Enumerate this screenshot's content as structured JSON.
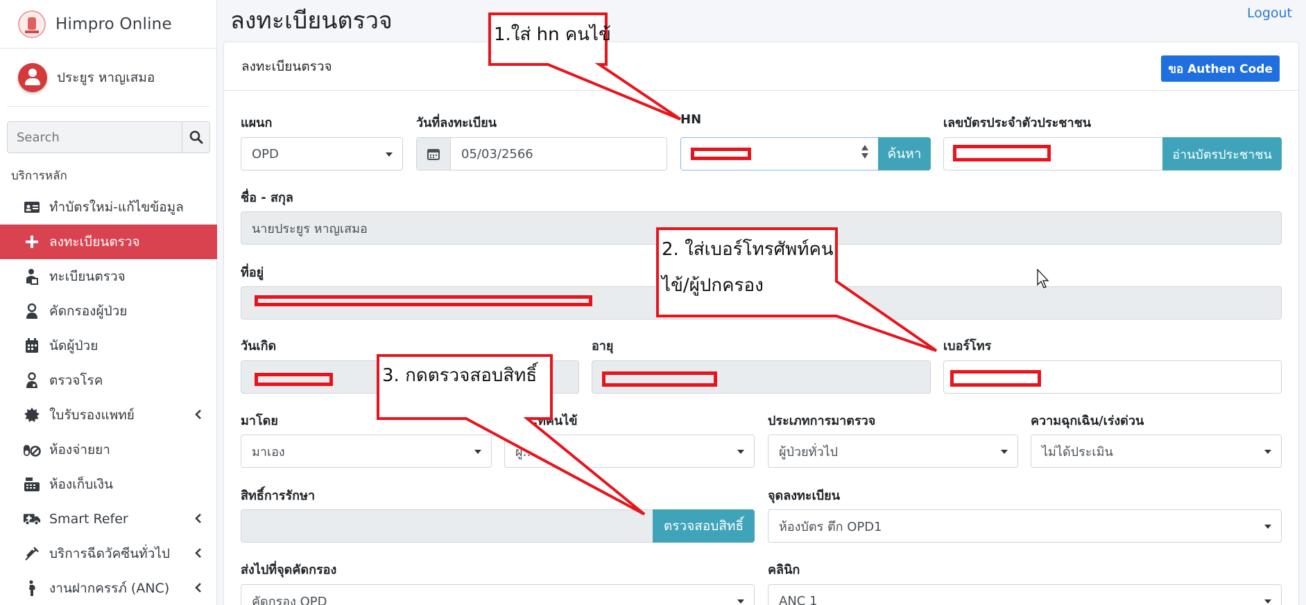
{
  "app": {
    "brand": "Himpro Online",
    "page_title": "ลงทะเบียนตรวจ",
    "logout": "Logout"
  },
  "user": {
    "name": "ประยูร หาญเสมอ"
  },
  "search": {
    "placeholder": "Search"
  },
  "sidebar": {
    "section": "บริการหลัก",
    "items": [
      {
        "label": "ทำบัตรใหม่-แก้ไขข้อมูล",
        "icon": "id-card-icon",
        "active": false
      },
      {
        "label": "ลงทะเบียนตรวจ",
        "icon": "plus-icon",
        "active": true
      },
      {
        "label": "ทะเบียนตรวจ",
        "icon": "patient-list-icon",
        "active": false
      },
      {
        "label": "คัดกรองผู้ป่วย",
        "icon": "nurse-icon",
        "active": false
      },
      {
        "label": "นัดผู้ป่วย",
        "icon": "calendar-icon",
        "active": false
      },
      {
        "label": "ตรวจโรค",
        "icon": "doctor-icon",
        "active": false
      },
      {
        "label": "ใบรับรองแพทย์",
        "icon": "certificate-icon",
        "active": false
      },
      {
        "label": "ห้องจ่ายยา",
        "icon": "pills-icon",
        "active": false
      },
      {
        "label": "ห้องเก็บเงิน",
        "icon": "cash-register-icon",
        "active": false
      },
      {
        "label": "Smart Refer",
        "icon": "ambulance-icon",
        "active": false
      },
      {
        "label": "บริการฉีดวัคซีนทั่วไป",
        "icon": "syringe-icon",
        "active": false
      },
      {
        "label": "งานฝากครรภ์ (ANC)",
        "icon": "pregnant-icon",
        "active": false
      }
    ]
  },
  "card": {
    "title": "ลงทะเบียนตรวจ",
    "authen_button": "ขอ Authen Code"
  },
  "form": {
    "department": {
      "label": "แผนก",
      "value": "OPD"
    },
    "register_date": {
      "label": "วันที่ลงทะเบียน",
      "value": "05/03/2566"
    },
    "hn": {
      "label": "HN",
      "button": "ค้นหา"
    },
    "citizen_id": {
      "label": "เลขบัตรประจำตัวประชาชน",
      "button": "อ่านบัตรประชาชน"
    },
    "fullname": {
      "label": "ชื่อ - สกุล",
      "value": "นายประยูร หาญเสมอ"
    },
    "address": {
      "label": "ที่อยู่"
    },
    "birthdate": {
      "label": "วันเกิด"
    },
    "age": {
      "label": "อายุ"
    },
    "phone": {
      "label": "เบอร์โทร"
    },
    "arrival": {
      "label": "มาโดย",
      "value": "มาเอง"
    },
    "patient_type": {
      "label": "…ท่คนไข้",
      "value": "ผู้…"
    },
    "exam_type": {
      "label": "ประเภทการมาตรวจ",
      "value": "ผู้ป่วยทั่วไป"
    },
    "urgency": {
      "label": "ความฉุกเฉิน/เร่งด่วน",
      "value": "ไม่ได้ประเมิน"
    },
    "right": {
      "label": "สิทธิ์การรักษา",
      "button": "ตรวจสอบสิทธิ์"
    },
    "register_point": {
      "label": "จุดลงทะเบียน",
      "value": "ห้องบัตร ตึก OPD1"
    },
    "send_to": {
      "label": "ส่งไปที่จุดคัดกรอง",
      "value": "คัดกรอง OPD"
    },
    "clinic": {
      "label": "คลินิก",
      "value": "ANC 1"
    }
  },
  "annotations": {
    "step1": "1.ใส่ hn คนไข้",
    "step2_line1": "2. ใส่เบอร์โทรศัพท์คน",
    "step2_line2": "ไข้/ผู้ปกครอง",
    "step3": "3. กดตรวจสอบสิทธิ์"
  },
  "colors": {
    "accent_red": "#d9434f",
    "info": "#3fa4ba",
    "primary": "#1f6fde",
    "annotation": "#e8141b"
  }
}
